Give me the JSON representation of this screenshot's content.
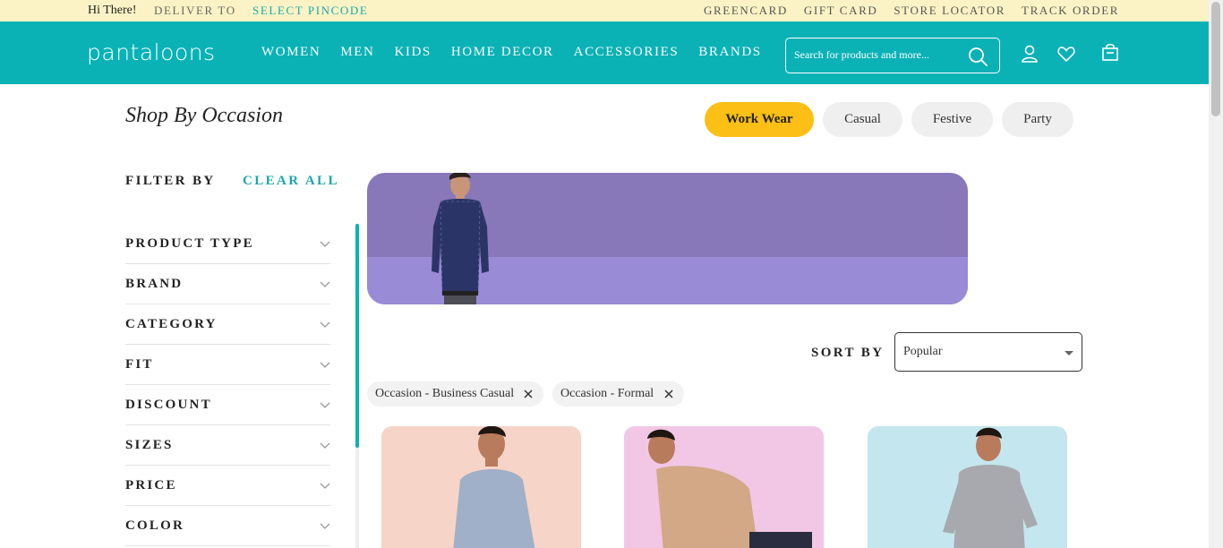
{
  "topbar": {
    "greeting": "Hi There!",
    "deliver_to": "DELIVER TO",
    "select_pincode": "SELECT PINCODE",
    "links": [
      "GREENCARD",
      "GIFT CARD",
      "STORE LOCATOR",
      "TRACK ORDER"
    ]
  },
  "header": {
    "logo": "pantaloons",
    "nav": [
      "WOMEN",
      "MEN",
      "KIDS",
      "HOME DECOR",
      "ACCESSORIES",
      "BRANDS"
    ],
    "search_placeholder": "Search for products and more...",
    "icons": [
      "user-icon",
      "heart-icon",
      "shopping-bag-icon"
    ]
  },
  "occasion": {
    "title": "Shop By Occasion",
    "pills": [
      "Work Wear",
      "Casual",
      "Festive",
      "Party"
    ],
    "active": "Work Wear"
  },
  "filters": {
    "heading": "FILTER BY",
    "clear_all": "CLEAR ALL",
    "items": [
      "PRODUCT TYPE",
      "BRAND",
      "CATEGORY",
      "FIT",
      "DISCOUNT",
      "SIZES",
      "PRICE",
      "COLOR"
    ]
  },
  "sort": {
    "label": "SORT BY",
    "selected": "Popular"
  },
  "applied_filters": [
    "Occasion - Business Casual",
    "Occasion - Formal"
  ],
  "colors": {
    "topbar_bg": "#fbf3c5",
    "header_bg": "#0ab2b6",
    "accent": "#1aa7ab",
    "active_pill": "#fbbf15",
    "banner_top": "#8878b9",
    "banner_bottom": "#9a8bd6"
  }
}
